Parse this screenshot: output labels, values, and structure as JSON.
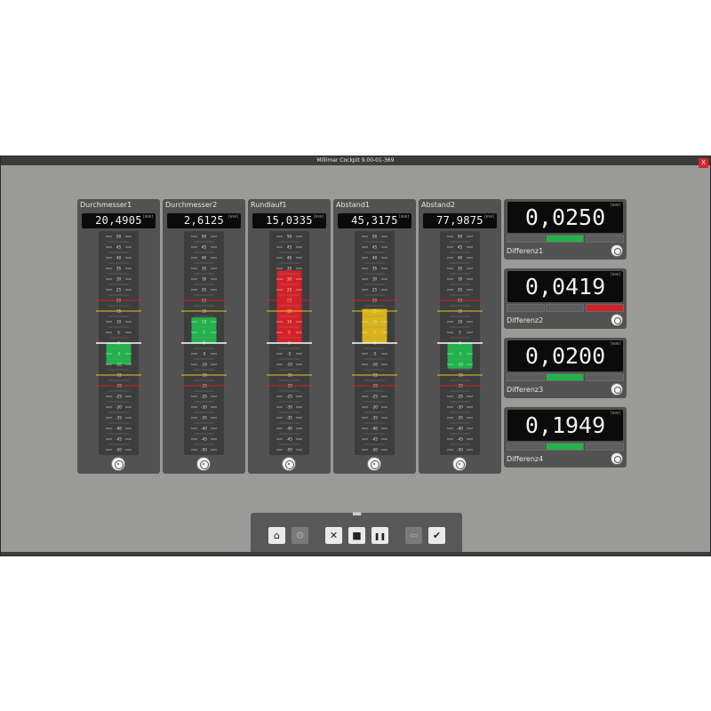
{
  "window": {
    "title": "Millimar Cockpit 9.00-01-369",
    "close_label": "X"
  },
  "unit_label": "[mm]",
  "scale": {
    "max": 50,
    "min": -50,
    "ticks": [
      "50",
      "45",
      "40",
      "35",
      "30",
      "25",
      "20",
      "15",
      "10",
      "5",
      "0",
      "-5",
      "-10",
      "-15",
      "-20",
      "-25",
      "-30",
      "-35",
      "-40",
      "-45",
      "-50"
    ],
    "red_limits": [
      20,
      -20
    ],
    "yellow_limits": [
      15,
      -15
    ]
  },
  "gauges": [
    {
      "name": "Durchmesser1",
      "value": "20,4905",
      "bar_from": -10,
      "bar_to": 0,
      "bar_color": "#22b24c",
      "bar_width": 0.62
    },
    {
      "name": "Durchmesser2",
      "value": "2,6125",
      "bar_from": 0,
      "bar_to": 12,
      "bar_color": "#22b24c",
      "bar_width": 0.62
    },
    {
      "name": "Rundlauf1",
      "value": "15,0335",
      "bar_from": 0,
      "bar_to": 34,
      "bar_color": "#d42127",
      "bar_width": 0.62
    },
    {
      "name": "Abstand1",
      "value": "45,3175",
      "bar_from": 0,
      "bar_to": 16,
      "bar_color": "#d9b418",
      "bar_width": 0.62
    },
    {
      "name": "Abstand2",
      "value": "77,9875",
      "bar_from": -12,
      "bar_to": 0,
      "bar_color": "#22b24c",
      "bar_width": 0.62
    }
  ],
  "diffs": [
    {
      "name": "Differenz1",
      "value": "0,0250",
      "segments": [
        "#5d5d5d",
        "#22b24c",
        "#5d5d5d"
      ]
    },
    {
      "name": "Differenz2",
      "value": "0,0419",
      "segments": [
        "#5d5d5d",
        "#5d5d5d",
        "#d42127"
      ]
    },
    {
      "name": "Differenz3",
      "value": "0,0200",
      "segments": [
        "#5d5d5d",
        "#22b24c",
        "#5d5d5d"
      ]
    },
    {
      "name": "Differenz4",
      "value": "0,1949",
      "segments": [
        "#5d5d5d",
        "#22b24c",
        "#5d5d5d"
      ]
    }
  ],
  "toolbar": {
    "buttons": [
      {
        "icon": "home-icon",
        "label": "⌂",
        "enabled": true
      },
      {
        "icon": "settings-icon",
        "label": "⚙",
        "enabled": false
      },
      {
        "icon": "cancel-icon",
        "label": "✕",
        "enabled": true
      },
      {
        "icon": "stop-icon",
        "label": "■",
        "enabled": true
      },
      {
        "icon": "pause-icon",
        "label": "❚❚",
        "enabled": true
      },
      {
        "icon": "exit-icon",
        "label": "⇦",
        "enabled": false
      },
      {
        "icon": "accept-icon",
        "label": "✔",
        "enabled": true
      }
    ]
  }
}
